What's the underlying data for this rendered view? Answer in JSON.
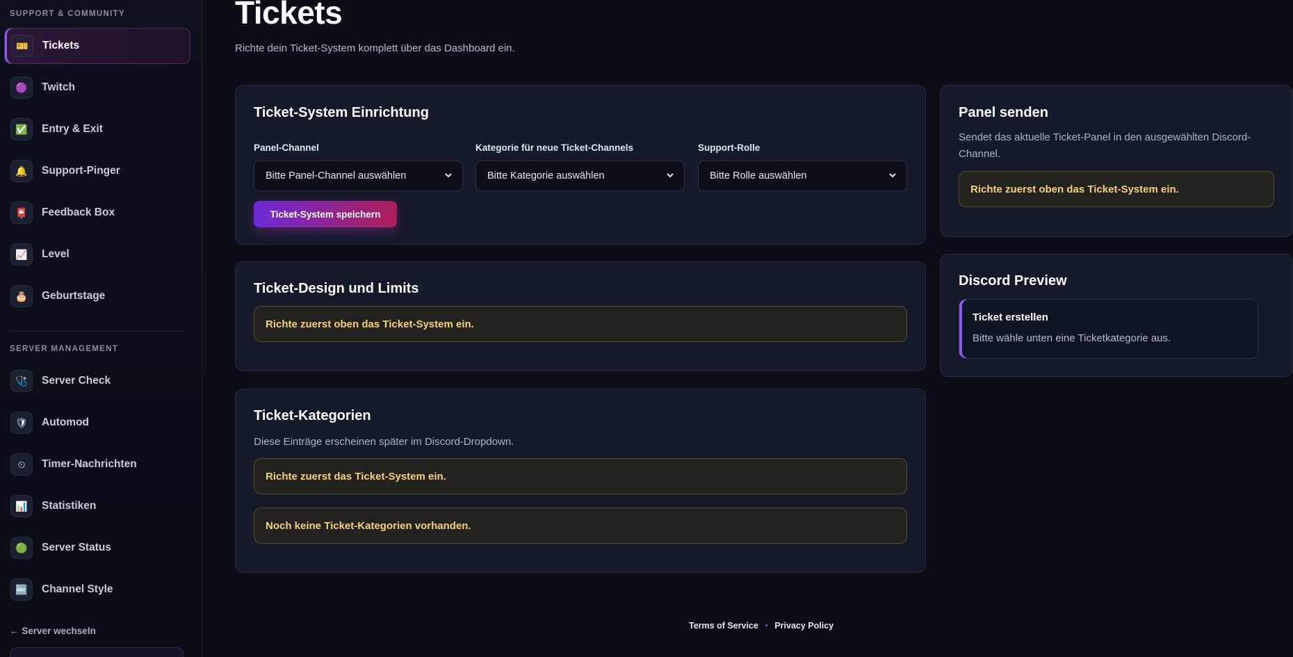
{
  "sidebar": {
    "sections": {
      "support": "SUPPORT & COMMUNITY",
      "server": "SERVER MANAGEMENT"
    },
    "items": [
      {
        "label": "Tickets",
        "icon": "🎫"
      },
      {
        "label": "Twitch",
        "icon": "🟣"
      },
      {
        "label": "Entry & Exit",
        "icon": "✅"
      },
      {
        "label": "Support-Pinger",
        "icon": "🔔"
      },
      {
        "label": "Feedback Box",
        "icon": "📮"
      },
      {
        "label": "Level",
        "icon": "📈"
      },
      {
        "label": "Geburtstage",
        "icon": "🎂"
      },
      {
        "label": "Server Check",
        "icon": "🩺"
      },
      {
        "label": "Automod",
        "icon": "🛡"
      },
      {
        "label": "Timer-Nachrichten",
        "icon": "⏲"
      },
      {
        "label": "Statistiken",
        "icon": "📊"
      },
      {
        "label": "Server Status",
        "icon": "🟢"
      },
      {
        "label": "Channel Style",
        "icon": "🔤"
      }
    ],
    "switch_server": "← Server wechseln"
  },
  "page": {
    "title": "Tickets",
    "subtitle": "Richte dein Ticket-System komplett über das Dashboard ein."
  },
  "setup_card": {
    "title": "Ticket-System Einrichtung",
    "panel_channel_label": "Panel-Channel",
    "panel_channel_value": "Bitte Panel-Channel auswählen",
    "category_label": "Kategorie für neue Ticket-Channels",
    "category_value": "Bitte Kategorie auswählen",
    "role_label": "Support-Rolle",
    "role_value": "Bitte Rolle auswählen",
    "save_label": "Ticket-System speichern"
  },
  "design_card": {
    "title": "Ticket-Design und Limits",
    "notice": "Richte zuerst oben das Ticket-System ein."
  },
  "categories_card": {
    "title": "Ticket-Kategorien",
    "description": "Diese Einträge erscheinen später im Discord-Dropdown.",
    "notice_setup": "Richte zuerst das Ticket-System ein.",
    "notice_empty": "Noch keine Ticket-Kategorien vorhanden."
  },
  "panel_card": {
    "title": "Panel senden",
    "description": "Sendet das aktuelle Ticket-Panel in den ausgewählten Discord-Channel.",
    "notice": "Richte zuerst oben das Ticket-System ein."
  },
  "preview_card": {
    "title": "Discord Preview",
    "embed_title": "Ticket erstellen",
    "embed_text": "Bitte wähle unten eine Ticketkategorie aus."
  },
  "footer": {
    "terms": "Terms of Service",
    "separator": "•",
    "privacy": "Privacy Policy"
  },
  "colors": {
    "accent": "#8b5cf6",
    "background": "#0b0e17",
    "card": "#141a29",
    "notice_text": "#f3d27a"
  }
}
